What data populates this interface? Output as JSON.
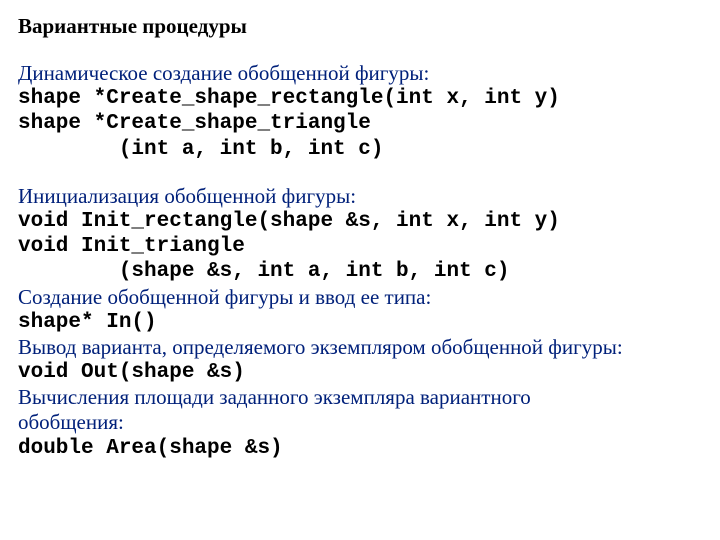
{
  "title": "Вариантные процедуры",
  "s1": {
    "prose": "Динамическое создание обобщенной фигуры:",
    "code1": "shape *Create_shape_rectangle(int x, int y)",
    "code2": "shape *Create_shape_triangle",
    "code3": "        (int a, int b, int c)"
  },
  "s2": {
    "prose": "Инициализация обобщенной фигуры:",
    "code1": "void Init_rectangle(shape &s, int x, int y)",
    "code2": "void Init_triangle",
    "code3": "        (shape &s, int a, int b, int c)"
  },
  "s3": {
    "prose": "Создание обобщенной фигуры и ввод ее типа:",
    "code1": "shape* In()"
  },
  "s4": {
    "prose": "Вывод варианта, определяемого экземпляром обобщенной фигуры:",
    "code1": "void Out(shape &s)"
  },
  "s5": {
    "prose1": "Вычисления площади заданного экземпляра вариантного",
    "prose2": "обобщения:",
    "code1": "double Area(shape &s)"
  }
}
